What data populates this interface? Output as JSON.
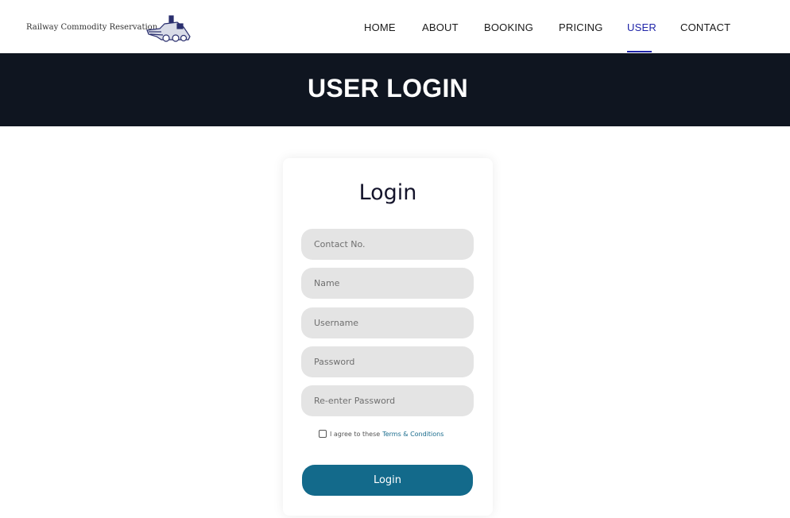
{
  "header": {
    "logo_text": "Railway Commodity Reservation",
    "logo_icon": "train-icon",
    "nav": [
      {
        "label": "HOME",
        "active": false
      },
      {
        "label": "ABOUT",
        "active": false
      },
      {
        "label": "BOOKING",
        "active": false
      },
      {
        "label": "PRICING",
        "active": false
      },
      {
        "label": "USER",
        "active": true
      },
      {
        "label": "CONTACT",
        "active": false
      }
    ]
  },
  "banner": {
    "title": "USER LOGIN"
  },
  "form": {
    "title": "Login",
    "fields": [
      {
        "placeholder": "Contact No.",
        "value": ""
      },
      {
        "placeholder": "Name",
        "value": ""
      },
      {
        "placeholder": "Username",
        "value": ""
      },
      {
        "placeholder": "Password",
        "value": ""
      },
      {
        "placeholder": "Re-enter Password",
        "value": ""
      }
    ],
    "agree_text": "I agree to these",
    "terms_link": "Terms & Conditions",
    "agree_checked": false,
    "submit_label": "Login"
  },
  "colors": {
    "banner_bg": "#0f1520",
    "active_nav": "#1f24a8",
    "button_bg": "#136a8b",
    "input_bg": "#e4e4e4"
  }
}
